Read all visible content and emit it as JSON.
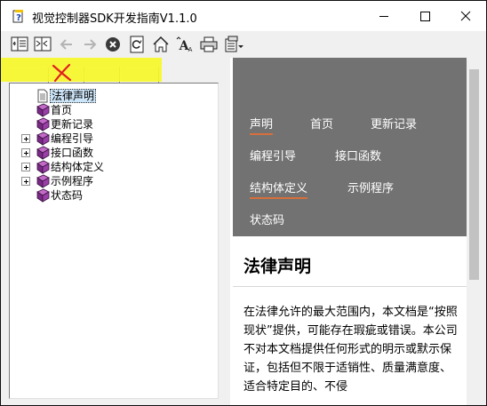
{
  "window": {
    "title": "视觉控制器SDK开发指南V1.1.0"
  },
  "caption_buttons": [
    "minimize-icon",
    "maximize-icon",
    "close-icon"
  ],
  "toolbar": {
    "items": [
      {
        "name": "hide-icon",
        "enabled": true
      },
      {
        "name": "locate-icon",
        "enabled": true
      },
      {
        "name": "back-arrow-icon",
        "enabled": false
      },
      {
        "name": "forward-arrow-icon",
        "enabled": false
      },
      {
        "name": "stop-icon",
        "enabled": true
      },
      {
        "name": "refresh-icon",
        "enabled": true
      },
      {
        "name": "home-icon",
        "enabled": true
      },
      {
        "name": "font-icon",
        "enabled": true
      },
      {
        "name": "print-icon",
        "enabled": true
      },
      {
        "name": "options-icon",
        "enabled": true
      }
    ]
  },
  "nav_tabs": {
    "annotation_mark": "X",
    "highlight_color": "#f7f72a",
    "mark_color": "#e02020"
  },
  "tree": {
    "items": [
      {
        "label": "法律声明",
        "icon": "page-icon",
        "expandable": false,
        "selected": true
      },
      {
        "label": "首页",
        "icon": "book-icon",
        "expandable": false,
        "selected": false
      },
      {
        "label": "更新记录",
        "icon": "book-icon",
        "expandable": false,
        "selected": false
      },
      {
        "label": "编程引导",
        "icon": "book-icon",
        "expandable": true,
        "selected": false
      },
      {
        "label": "接口函数",
        "icon": "book-icon",
        "expandable": true,
        "selected": false
      },
      {
        "label": "结构体定义",
        "icon": "book-icon",
        "expandable": true,
        "selected": false
      },
      {
        "label": "示例程序",
        "icon": "book-icon",
        "expandable": true,
        "selected": false
      },
      {
        "label": "状态码",
        "icon": "book-icon",
        "expandable": false,
        "selected": false
      }
    ]
  },
  "content": {
    "nav_links": [
      {
        "label": "声明",
        "underlined": true
      },
      {
        "label": "首页",
        "underlined": false
      },
      {
        "label": "更新记录",
        "underlined": false
      },
      {
        "label": "编程引导",
        "underlined": false
      },
      {
        "label": "接口函数",
        "underlined": false
      },
      {
        "label": "结构体定义",
        "underlined": true
      },
      {
        "label": "示例程序",
        "underlined": false
      },
      {
        "label": "状态码",
        "underlined": false
      }
    ],
    "heading": "法律声明",
    "paragraph": "在法律允许的最大范围内，本文档是“按照现状”提供，可能存在瑕疵或错误。本公司不对本文档提供任何形式的明示或默示保证，包括但不限于适销性、质量满意度、适合特定目的、不侵"
  },
  "colors": {
    "nav_bg": "#727272",
    "nav_underline": "#d76f3a",
    "selection": "#cce4f7"
  }
}
